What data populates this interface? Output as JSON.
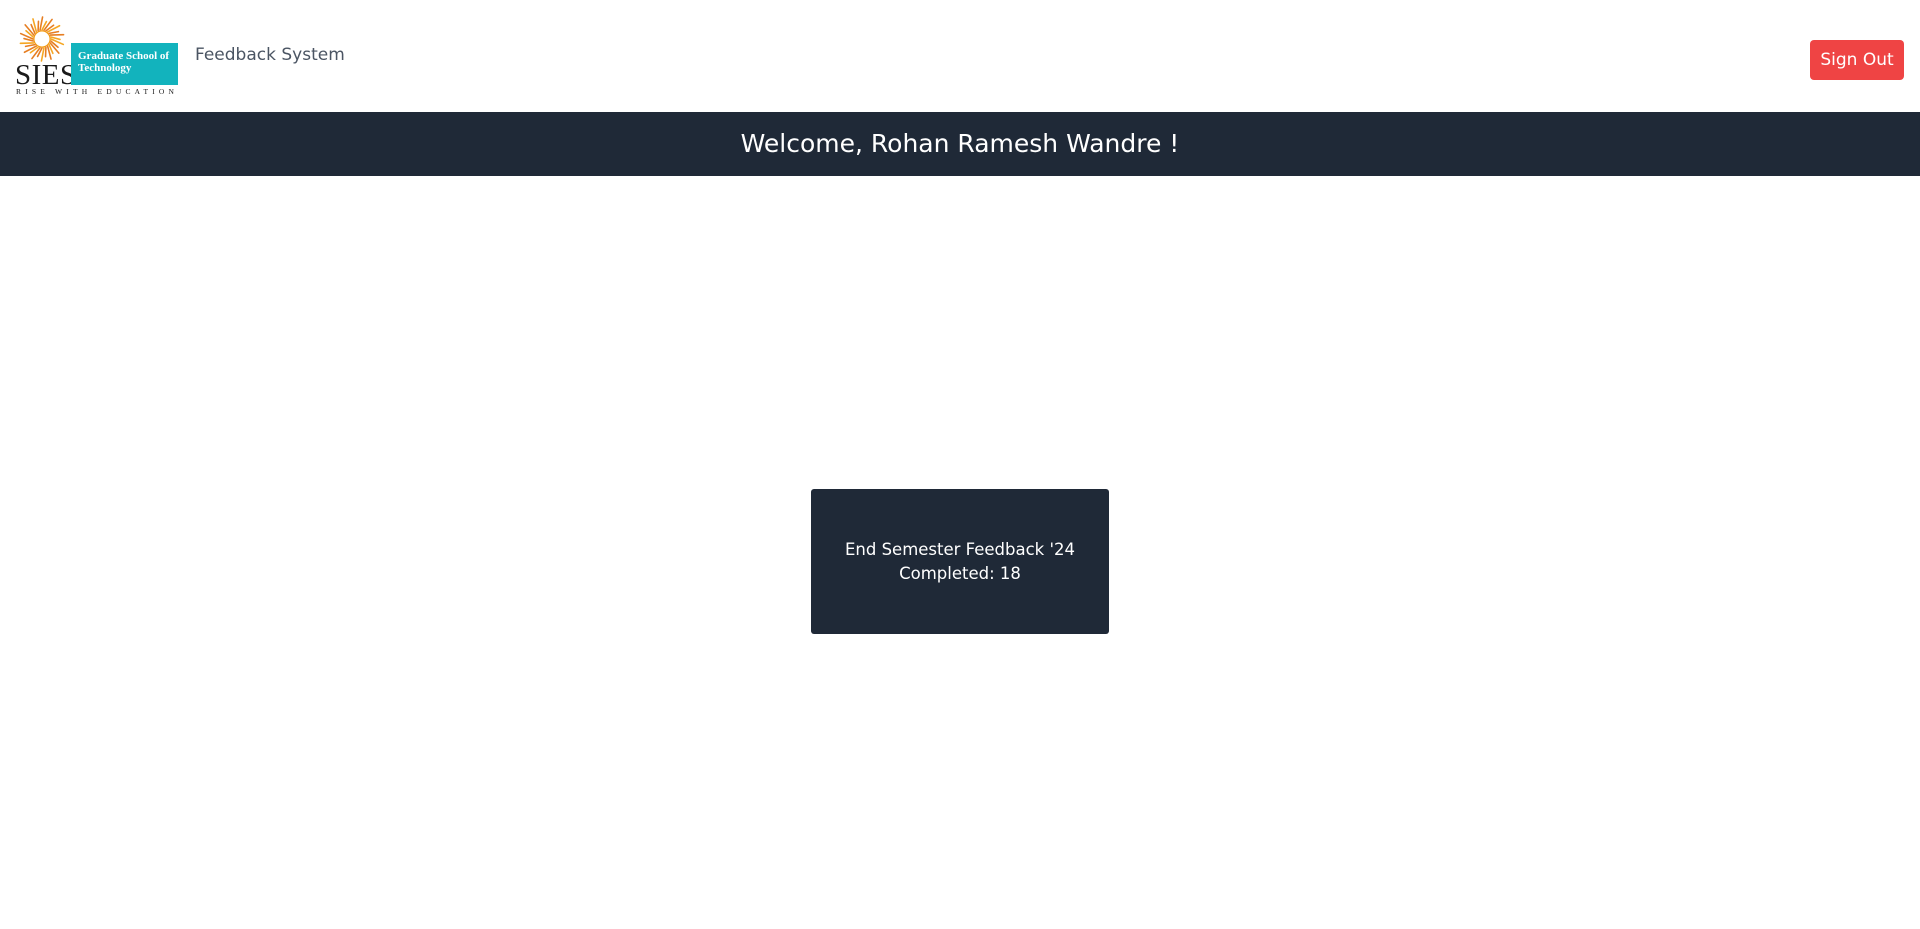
{
  "header": {
    "logo": {
      "wordmark": "SIES",
      "box_line1": "Graduate School of",
      "box_line2": "Technology",
      "tagline": "RISE WITH EDUCATION",
      "brand_color": "#12b3bd",
      "sun_color": "#e67e22"
    },
    "app_name": "Feedback System",
    "sign_out_label": "Sign Out",
    "sign_out_color": "#ef4444"
  },
  "welcome": {
    "text": "Welcome, Rohan Ramesh Wandre !",
    "bar_color": "#1f2937"
  },
  "feedback_card": {
    "title": "End Semester Feedback '24",
    "completed_label": "Completed:",
    "completed_count": "18",
    "card_color": "#1f2937"
  }
}
